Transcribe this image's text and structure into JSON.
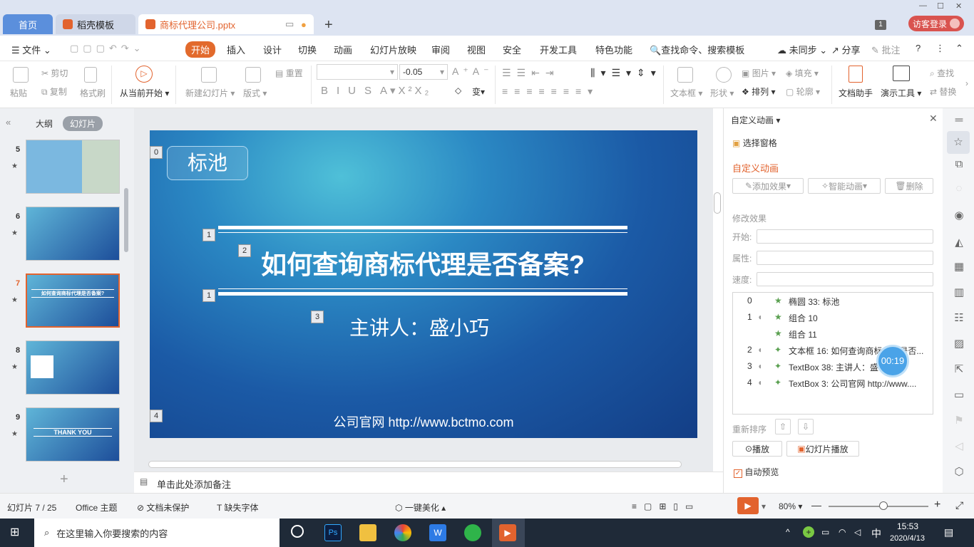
{
  "window": {
    "tabs": [
      {
        "label": "首页"
      },
      {
        "label": "稻壳模板"
      },
      {
        "label": "商标代理公司.pptx"
      }
    ],
    "window_count": "1",
    "login_label": "访客登录"
  },
  "menu": {
    "file": "文件",
    "items": [
      "开始",
      "插入",
      "设计",
      "切换",
      "动画",
      "幻灯片放映",
      "审阅",
      "视图",
      "安全",
      "开发工具",
      "特色功能"
    ],
    "search": "查找命令、搜索模板",
    "sync": "未同步",
    "share": "分享",
    "comment": "批注"
  },
  "toolbar": {
    "paste": "粘贴",
    "cut": "剪切",
    "copy": "复制",
    "format_painter": "格式刷",
    "from_current": "从当前开始",
    "new_slide": "新建幻灯片",
    "layout": "版式",
    "reset": "重置",
    "font_size": "-0.05",
    "text_box": "文本框",
    "shape": "形状",
    "arrange": "排列",
    "picture": "图片",
    "fill": "填充",
    "outline": "轮廓",
    "doc_helper": "文档助手",
    "present_tool": "演示工具",
    "find": "查找",
    "replace": "替换"
  },
  "left_panel": {
    "tab_outline": "大纲",
    "tab_slides": "幻灯片",
    "slides": [
      {
        "num": "5"
      },
      {
        "num": "6"
      },
      {
        "num": "7"
      },
      {
        "num": "8"
      },
      {
        "num": "9"
      }
    ],
    "thumb7_title": "如何查询商标代理是否备案?",
    "thumb9_title": "THANK YOU"
  },
  "slide": {
    "badge": "标池",
    "title": "如何查询商标代理是否备案?",
    "speaker": "主讲人：盛小巧",
    "website": "公司官网 http://www.bctmo.com",
    "tags": [
      "0",
      "1",
      "2",
      "1",
      "3",
      "4"
    ]
  },
  "notes_placeholder": "单击此处添加备注",
  "right_panel": {
    "header": "自定义动画",
    "select_pane": "选择窗格",
    "section_title": "自定义动画",
    "add_effect": "添加效果",
    "smart_anim": "智能动画",
    "delete": "删除",
    "modify": "修改效果",
    "start_label": "开始:",
    "prop_label": "属性:",
    "speed_label": "速度:",
    "animations": [
      {
        "idx": "0",
        "label": "椭圆 33: 标池"
      },
      {
        "idx": "1",
        "label": "组合 10"
      },
      {
        "idx": "",
        "label": "组合 11"
      },
      {
        "idx": "2",
        "label": "文本框 16: 如何查询商标代理是否..."
      },
      {
        "idx": "3",
        "label": "TextBox 38: 主讲人：盛"
      },
      {
        "idx": "4",
        "label": "TextBox 3: 公司官网 http://www...."
      }
    ],
    "timer": "00:19",
    "reorder": "重新排序",
    "play": "播放",
    "slideshow": "幻灯片播放",
    "auto_preview": "自动预览"
  },
  "status": {
    "slide_pos": "幻灯片 7 / 25",
    "theme": "Office 主题",
    "protect": "文档未保护",
    "missing_font": "缺失字体",
    "beautify": "一键美化",
    "zoom": "80%",
    "zoom_fraction": 0.55
  },
  "taskbar": {
    "search": "在这里输入你要搜索的内容",
    "ime": "中",
    "time": "15:53",
    "date": "2020/4/13"
  }
}
